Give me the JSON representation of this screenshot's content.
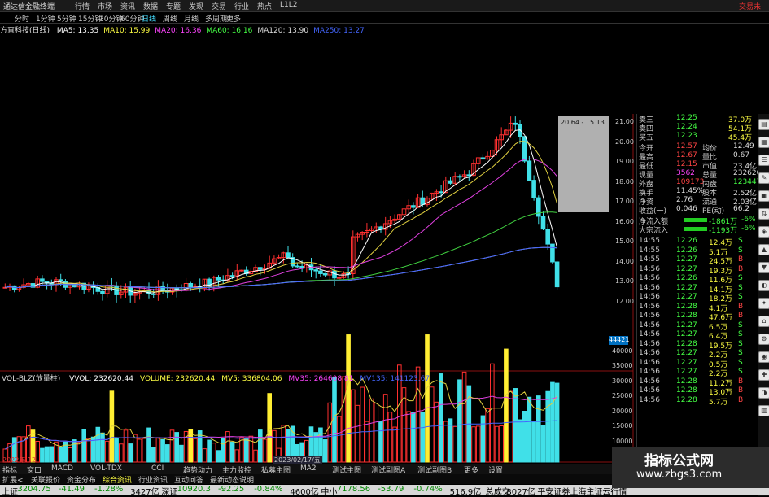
{
  "window": {
    "title": "通达信金融终端",
    "right_text": "交易未"
  },
  "menu": [
    "行情",
    "市场",
    "资讯",
    "数据",
    "专题",
    "发现",
    "交易",
    "行业",
    "热点",
    "L1L2"
  ],
  "periods": [
    {
      "label": "分时"
    },
    {
      "label": "1分钟"
    },
    {
      "label": "5分钟"
    },
    {
      "label": "15分钟"
    },
    {
      "label": "30分钟"
    },
    {
      "label": "60分钟"
    },
    {
      "label": "日线",
      "active": true
    },
    {
      "label": "周线"
    },
    {
      "label": "月线"
    },
    {
      "label": "多周期"
    },
    {
      "label": "更多"
    }
  ],
  "stock": {
    "name": "方直科技(日线)"
  },
  "ma": [
    {
      "label": "MA5: 13.35",
      "color": "#ffffff"
    },
    {
      "label": "MA10: 15.99",
      "color": "#ffff44"
    },
    {
      "label": "MA20: 16.36",
      "color": "#ff44ff"
    },
    {
      "label": "MA60: 16.16",
      "color": "#44ff44"
    },
    {
      "label": "MA120: 13.90",
      "color": "#dddddd"
    },
    {
      "label": "MA250: 13.27",
      "color": "#4466ff"
    }
  ],
  "price_axis": [
    "21.00",
    "20.00",
    "19.00",
    "18.00",
    "17.00",
    "16.00",
    "15.00",
    "14.00",
    "13.00",
    "12.00"
  ],
  "volume": {
    "indicator": "VOL-BLZ(放量柱)",
    "items": [
      {
        "label": "VVOL: 232620.44",
        "color": "#ffffff"
      },
      {
        "label": "VOLUME: 232620.44",
        "color": "#ffff44"
      },
      {
        "label": "MV5: 336804.06",
        "color": "#ffff44"
      },
      {
        "label": "MV35: 264608.81",
        "color": "#ff44ff"
      },
      {
        "label": "MV135: 141123.67",
        "color": "#4466ff"
      }
    ],
    "axis": [
      "44421",
      "40000",
      "35000",
      "30000",
      "25000",
      "20000",
      "15000",
      "10000"
    ]
  },
  "popup": {
    "text": "20.64 - 15.13"
  },
  "dates": {
    "year": "2022年 12",
    "date": "2023/02/17/五"
  },
  "quote_panel": {
    "asks": [
      {
        "k": "卖三",
        "p": "12.25",
        "v": "37.0万"
      },
      {
        "k": "卖四",
        "p": "12.24",
        "v": "54.1万"
      },
      {
        "k": "买五",
        "p": "12.23",
        "v": "45.4万"
      }
    ],
    "stats": [
      {
        "k": "今开",
        "v": "12.57",
        "k2": "均价",
        "v2": "12.49"
      },
      {
        "k": "最高",
        "v": "12.67",
        "k2": "量比",
        "v2": "0.67"
      },
      {
        "k": "最低",
        "v": "12.15",
        "k2": "市值",
        "v2": "23.4亿"
      },
      {
        "k": "现量",
        "v": "3562",
        "k2": "总量",
        "v2": "232620"
      },
      {
        "k": "外盘",
        "v": "109173",
        "k2": "内盘",
        "v2": "123447"
      },
      {
        "k": "换手",
        "v": "11.45%",
        "k2": "股本",
        "v2": "2.52亿"
      },
      {
        "k": "净资",
        "v": "2.76",
        "k2": "流通",
        "v2": "2.03亿"
      },
      {
        "k": "收益(一)",
        "v": "0.046",
        "k2": "PE(动)",
        "v2": "66.2"
      }
    ],
    "flows": [
      {
        "k": "净流入额",
        "v": "-1861万",
        "pct": "-6%"
      },
      {
        "k": "大宗流入",
        "v": "-1193万",
        "pct": "-6%"
      }
    ],
    "ticks": [
      {
        "t": "14:55",
        "p": "12.26",
        "v": "12.4万",
        "s": "S"
      },
      {
        "t": "14:55",
        "p": "12.26",
        "v": "5.1万",
        "s": "S"
      },
      {
        "t": "14:55",
        "p": "12.27",
        "v": "24.5万",
        "s": "B"
      },
      {
        "t": "14:56",
        "p": "12.27",
        "v": "19.3万",
        "s": "B"
      },
      {
        "t": "14:56",
        "p": "12.26",
        "v": "11.6万",
        "s": "S"
      },
      {
        "t": "14:56",
        "p": "12.27",
        "v": "14.1万",
        "s": "S"
      },
      {
        "t": "14:56",
        "p": "12.27",
        "v": "18.2万",
        "s": "S"
      },
      {
        "t": "14:56",
        "p": "12.28",
        "v": "4.1万",
        "s": "B"
      },
      {
        "t": "14:56",
        "p": "12.28",
        "v": "47.6万",
        "s": "B"
      },
      {
        "t": "14:56",
        "p": "12.27",
        "v": "6.5万",
        "s": "S"
      },
      {
        "t": "14:56",
        "p": "12.27",
        "v": "6.4万",
        "s": "S"
      },
      {
        "t": "14:56",
        "p": "12.28",
        "v": "19.5万",
        "s": "S"
      },
      {
        "t": "14:56",
        "p": "12.27",
        "v": "2.2万",
        "s": "S"
      },
      {
        "t": "14:56",
        "p": "12.27",
        "v": "0.5万",
        "s": "S"
      },
      {
        "t": "14:56",
        "p": "12.27",
        "v": "2.2万",
        "s": "S"
      },
      {
        "t": "14:56",
        "p": "12.28",
        "v": "11.2万",
        "s": "B"
      },
      {
        "t": "14:56",
        "p": "12.28",
        "v": "13.0万",
        "s": "B"
      },
      {
        "t": "14:56",
        "p": "12.28",
        "v": "5.7万",
        "s": "B"
      }
    ]
  },
  "bottom_tabs": [
    "指标",
    "窗口",
    "MACD",
    "VOL-TDX",
    "CCI",
    "趋势动力",
    "主力监控",
    "私募主图",
    "MA2",
    "测试主图",
    "测试副图A",
    "测试副图B",
    "更多",
    "设置"
  ],
  "bottom_left": [
    "扩展<",
    "关联报价",
    "资金分布",
    "综合资讯",
    "行业资讯",
    "互动问答",
    "最新动态说明"
  ],
  "status": [
    {
      "t": "上证",
      "color": "#000"
    },
    {
      "t": "3204.75",
      "color": "#080"
    },
    {
      "t": "-41.49",
      "color": "#080"
    },
    {
      "t": "-1.28%",
      "color": "#080"
    },
    {
      "t": "3427亿",
      "color": "#000"
    },
    {
      "t": "深证",
      "color": "#000"
    },
    {
      "t": "10920.3",
      "color": "#080"
    },
    {
      "t": "-92.25",
      "color": "#080"
    },
    {
      "t": "-0.84%",
      "color": "#080"
    },
    {
      "t": "4600亿",
      "color": "#000"
    },
    {
      "t": "中小",
      "color": "#000"
    },
    {
      "t": "7178.56",
      "color": "#080"
    },
    {
      "t": "-53.79",
      "color": "#080"
    },
    {
      "t": "-0.74%",
      "color": "#080"
    },
    {
      "t": "516.9亿",
      "color": "#000"
    },
    {
      "t": "总成交",
      "color": "#000"
    },
    {
      "t": "8027亿",
      "color": "#000"
    },
    {
      "t": "平安证券上海主证云行情",
      "color": "#000"
    }
  ],
  "watermark": {
    "line1": "指标公式网",
    "line2": "www.zbgs3.com"
  }
}
